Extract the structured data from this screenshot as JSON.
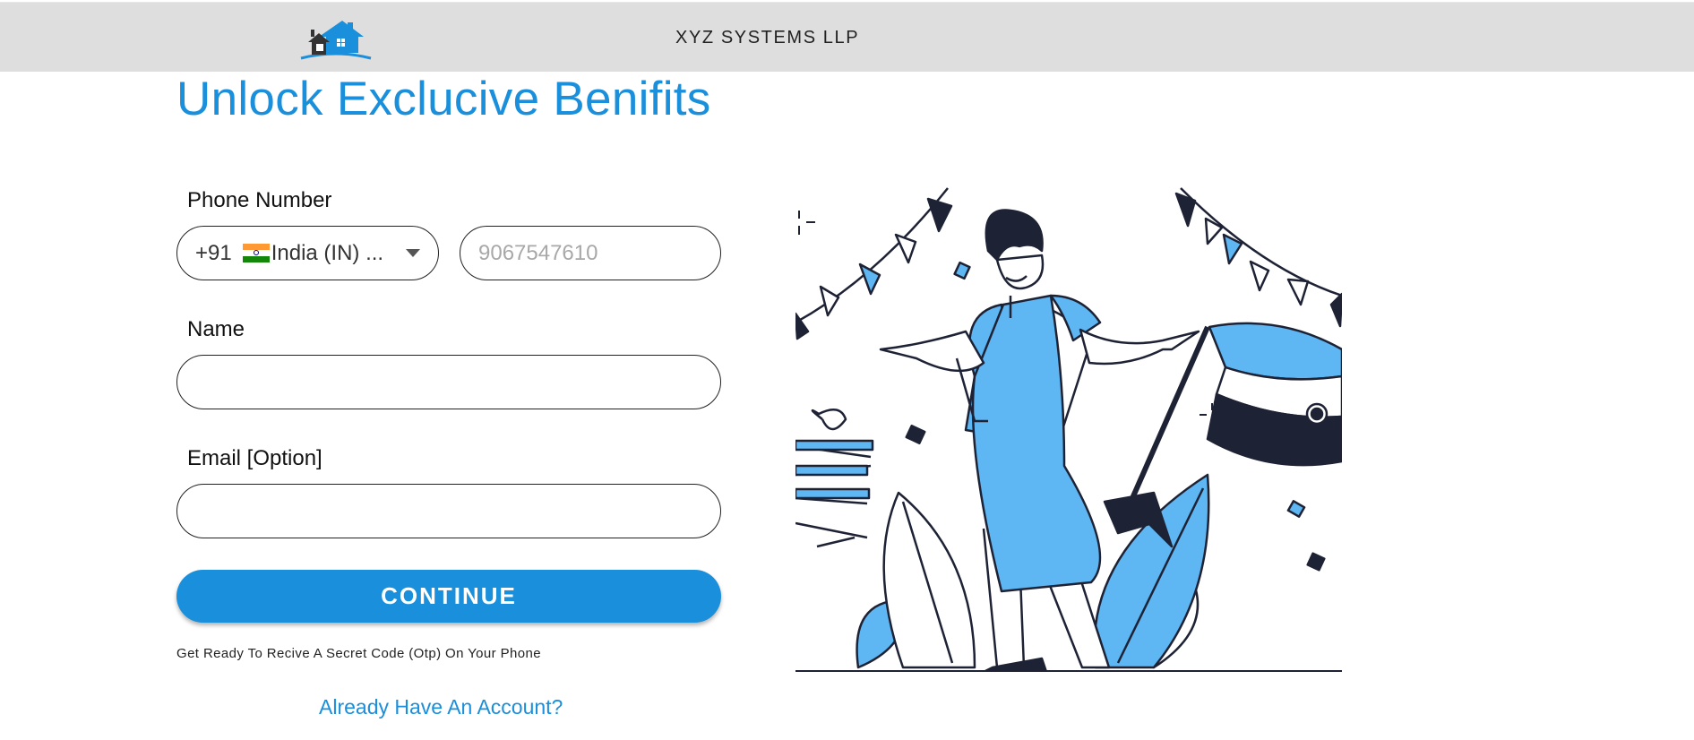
{
  "header": {
    "company_name": "XYZ SYSTEMS LLP",
    "logo_icon": "house-logo-icon"
  },
  "page": {
    "headline": "Unlock Exclucive Benifits"
  },
  "form": {
    "phone_label": "Phone Number",
    "country_code": "+91",
    "country_name": "India (IN) ...",
    "country_flag_icon": "india-flag-icon",
    "phone_placeholder": "9067547610",
    "name_label": "Name",
    "name_value": "",
    "email_label": "Email [Option]",
    "email_value": "",
    "continue_label": "CONTINUE",
    "otp_hint": "Get Ready To Recive A Secret Code (Otp) On Your Phone",
    "login_link": "Already Have An Account?"
  },
  "colors": {
    "accent": "#1a8fdc",
    "header_bg": "#dedede",
    "illustration_blue": "#5eb6f2",
    "illustration_dark": "#1e2235"
  }
}
